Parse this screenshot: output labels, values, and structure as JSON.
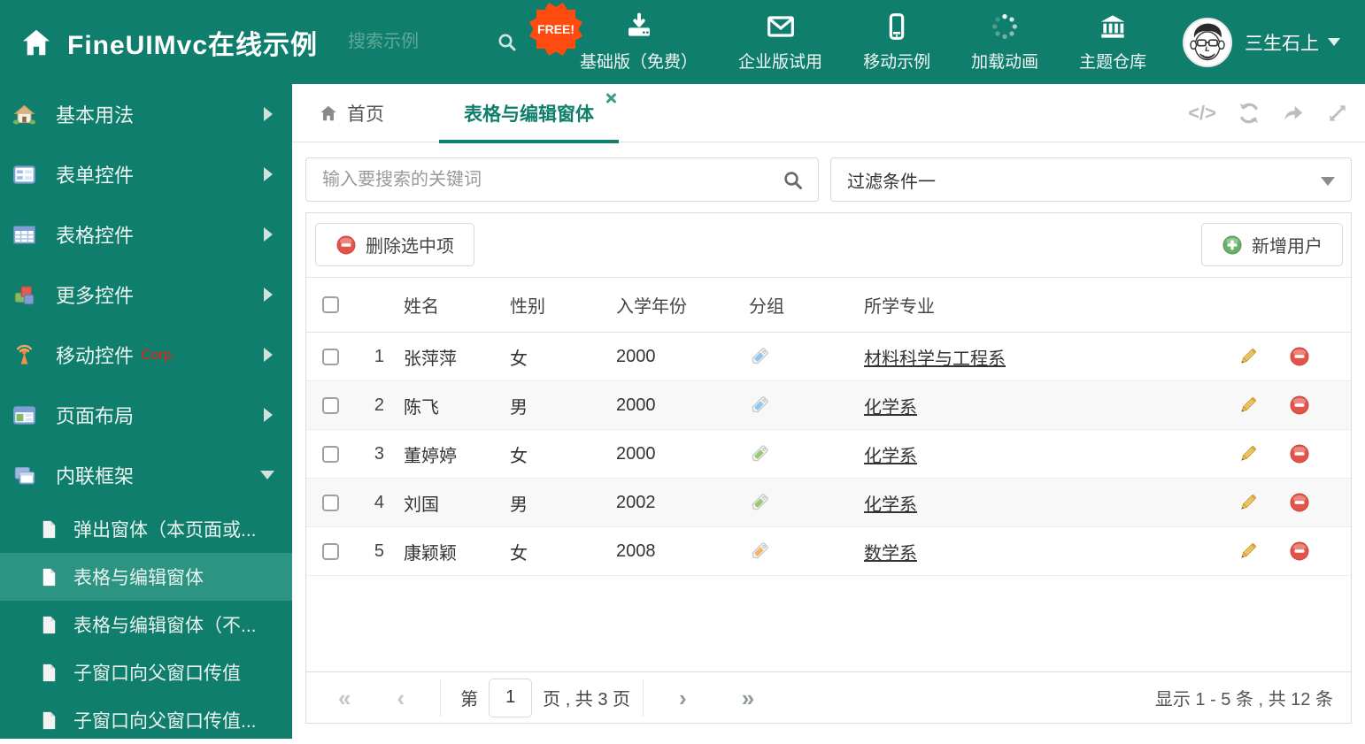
{
  "header": {
    "title": "FineUIMvc在线示例",
    "search_placeholder": "搜索示例",
    "badge": "FREE!",
    "nav": [
      {
        "label": "基础版（免费）",
        "icon": "download-icon"
      },
      {
        "label": "企业版试用",
        "icon": "envelope-icon"
      },
      {
        "label": "移动示例",
        "icon": "mobile-icon"
      },
      {
        "label": "加载动画",
        "icon": "spinner-icon"
      },
      {
        "label": "主题仓库",
        "icon": "bank-icon"
      }
    ],
    "user": {
      "name": "三生石上"
    }
  },
  "sidebar": {
    "items": [
      {
        "label": "基本用法"
      },
      {
        "label": "表单控件"
      },
      {
        "label": "表格控件"
      },
      {
        "label": "更多控件"
      },
      {
        "label": "移动控件",
        "suffix": "Corp."
      },
      {
        "label": "页面布局"
      },
      {
        "label": "内联框架"
      }
    ],
    "subitems": [
      {
        "label": "弹出窗体（本页面或..."
      },
      {
        "label": "表格与编辑窗体"
      },
      {
        "label": "表格与编辑窗体（不..."
      },
      {
        "label": "子窗口向父窗口传值"
      },
      {
        "label": "子窗口向父窗口传值..."
      }
    ]
  },
  "tabs": [
    {
      "label": "首页"
    },
    {
      "label": "表格与编辑窗体"
    }
  ],
  "tab_tools": {
    "code_icon": "</>"
  },
  "filters": {
    "search_placeholder": "输入要搜索的关键词",
    "filter_value": "过滤条件一"
  },
  "toolbar": {
    "delete_label": "删除选中项",
    "add_label": "新增用户"
  },
  "table": {
    "columns": [
      "姓名",
      "性别",
      "入学年份",
      "分组",
      "所学专业"
    ],
    "rows": [
      {
        "num": "1",
        "name": "张萍萍",
        "gender": "女",
        "year": "2000",
        "tag_color": "#8DC8F3",
        "major": "材料科学与工程系"
      },
      {
        "num": "2",
        "name": "陈飞",
        "gender": "男",
        "year": "2000",
        "tag_color": "#8DC8F3",
        "major": "化学系"
      },
      {
        "num": "3",
        "name": "董婷婷",
        "gender": "女",
        "year": "2000",
        "tag_color": "#96CA70",
        "major": "化学系"
      },
      {
        "num": "4",
        "name": "刘国",
        "gender": "男",
        "year": "2002",
        "tag_color": "#96CA70",
        "major": "化学系"
      },
      {
        "num": "5",
        "name": "康颖颖",
        "gender": "女",
        "year": "2008",
        "tag_color": "#F6B26D",
        "major": "数学系"
      }
    ]
  },
  "pagination": {
    "first_icon": "«",
    "prev_icon": "‹",
    "next_icon": "›",
    "last_icon": "»",
    "page_prefix": "第",
    "page_value": "1",
    "page_suffix": "页 , 共 3 页",
    "summary": "显示 1 - 5 条 , 共 12 条"
  },
  "colors": {
    "accent_teal": "#107E6C",
    "selected_teal": "#2D9483",
    "badge_orange": "#FF4B0F",
    "delete_red": "#E25449",
    "add_green": "#67B168"
  }
}
